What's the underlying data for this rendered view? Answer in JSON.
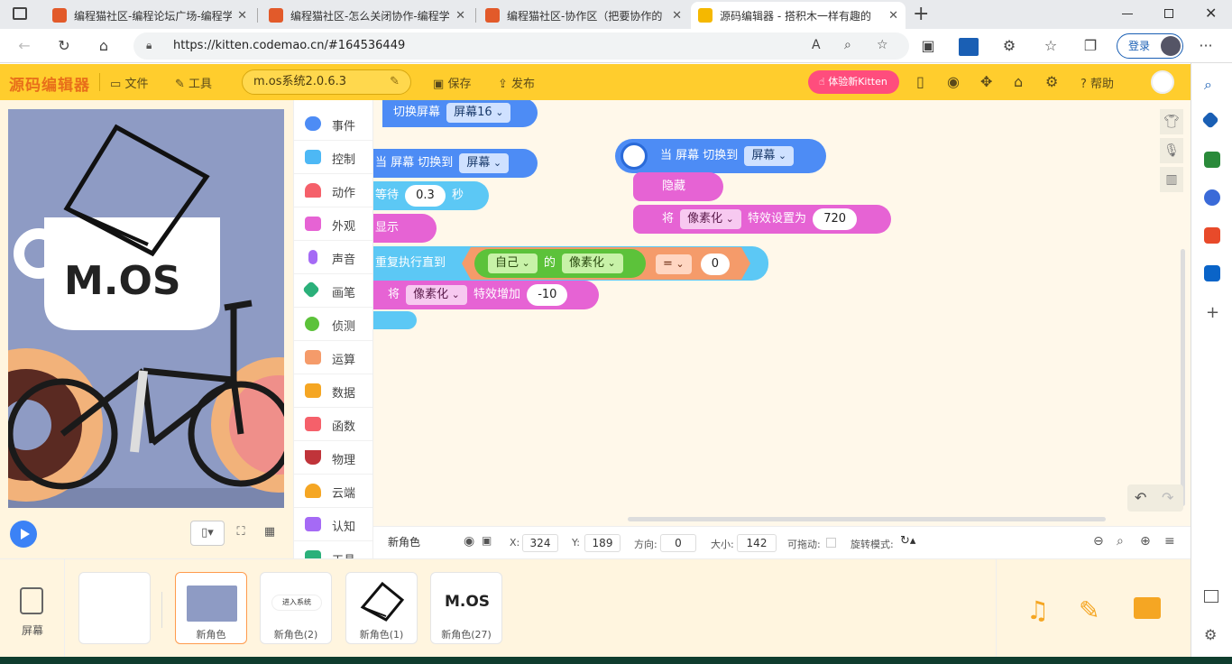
{
  "browser": {
    "tabs": [
      {
        "title": "编程猫社区-编程论坛广场-编程学",
        "close": "✕",
        "icon_color": "#e25a2a"
      },
      {
        "title": "编程猫社区-怎么关闭协作-编程学",
        "close": "✕",
        "icon_color": "#e25a2a"
      },
      {
        "title": "编程猫社区-协作区（把要协作的",
        "close": "✕",
        "icon_color": "#e25a2a"
      },
      {
        "title": "源码编辑器 - 搭积木一样有趣的",
        "close": "✕",
        "icon_color": "#f5b800"
      }
    ],
    "new_tab": "+",
    "url": "https://kitten.codemao.cn/#164536449",
    "login_label": "登录",
    "more": "···"
  },
  "app": {
    "logo": "源码编辑器",
    "menu_file": "文件",
    "menu_tools": "工具",
    "project_name": "m.os系统2.0.6.3",
    "save": "保存",
    "publish": "发布",
    "try_new": "体验新Kitten",
    "help": "帮助"
  },
  "categories": [
    {
      "label": "事件",
      "color": "#4d8cf5"
    },
    {
      "label": "控制",
      "color": "#4db8f5"
    },
    {
      "label": "动作",
      "color": "#f5606a"
    },
    {
      "label": "外观",
      "color": "#e663d4"
    },
    {
      "label": "声音",
      "color": "#a56af5"
    },
    {
      "label": "画笔",
      "color": "#2bb07a"
    },
    {
      "label": "侦测",
      "color": "#5cc23a"
    },
    {
      "label": "运算",
      "color": "#f59b6a"
    },
    {
      "label": "数据",
      "color": "#f5a623"
    },
    {
      "label": "函数",
      "color": "#f5606a"
    },
    {
      "label": "物理",
      "color": "#c0343a"
    },
    {
      "label": "云端",
      "color": "#f5a623"
    },
    {
      "label": "认知",
      "color": "#a56af5"
    },
    {
      "label": "工具",
      "color": "#2bb07a"
    }
  ],
  "blocks": {
    "switch_screen": "切换屏幕",
    "screen16": "屏幕16",
    "when_screen_switched": "当 屏幕 切换到",
    "screen": "屏幕",
    "wait": "等待",
    "wait_value": "0.3",
    "seconds": "秒",
    "show": "显示",
    "repeat_until": "重复执行直到",
    "self": "自己",
    "of": "的",
    "pixelate": "像素化",
    "equals": "=",
    "zero": "0",
    "set": "将",
    "effect_increase": "特效增加",
    "increase_value": "-10",
    "hide": "隐藏",
    "effect_set_to": "特效设置为",
    "set_value": "720"
  },
  "props": {
    "sprite_name": "新角色",
    "x_label": "X:",
    "x": "324",
    "y_label": "Y:",
    "y": "189",
    "dir_label": "方向:",
    "dir": "0",
    "size_label": "大小:",
    "size": "142",
    "drag_label": "可拖动:",
    "rot_label": "旋转模式:"
  },
  "sprites": {
    "screen_label": "屏幕",
    "items": [
      {
        "label": ""
      },
      {
        "label": "新角色"
      },
      {
        "label": "新角色(2)"
      },
      {
        "label": "新角色(1)"
      },
      {
        "label": "新角色(27)"
      }
    ],
    "thumb_text_2": "进入系统",
    "thumb_text_4": "M.OS"
  },
  "stage_text": "M.OS"
}
